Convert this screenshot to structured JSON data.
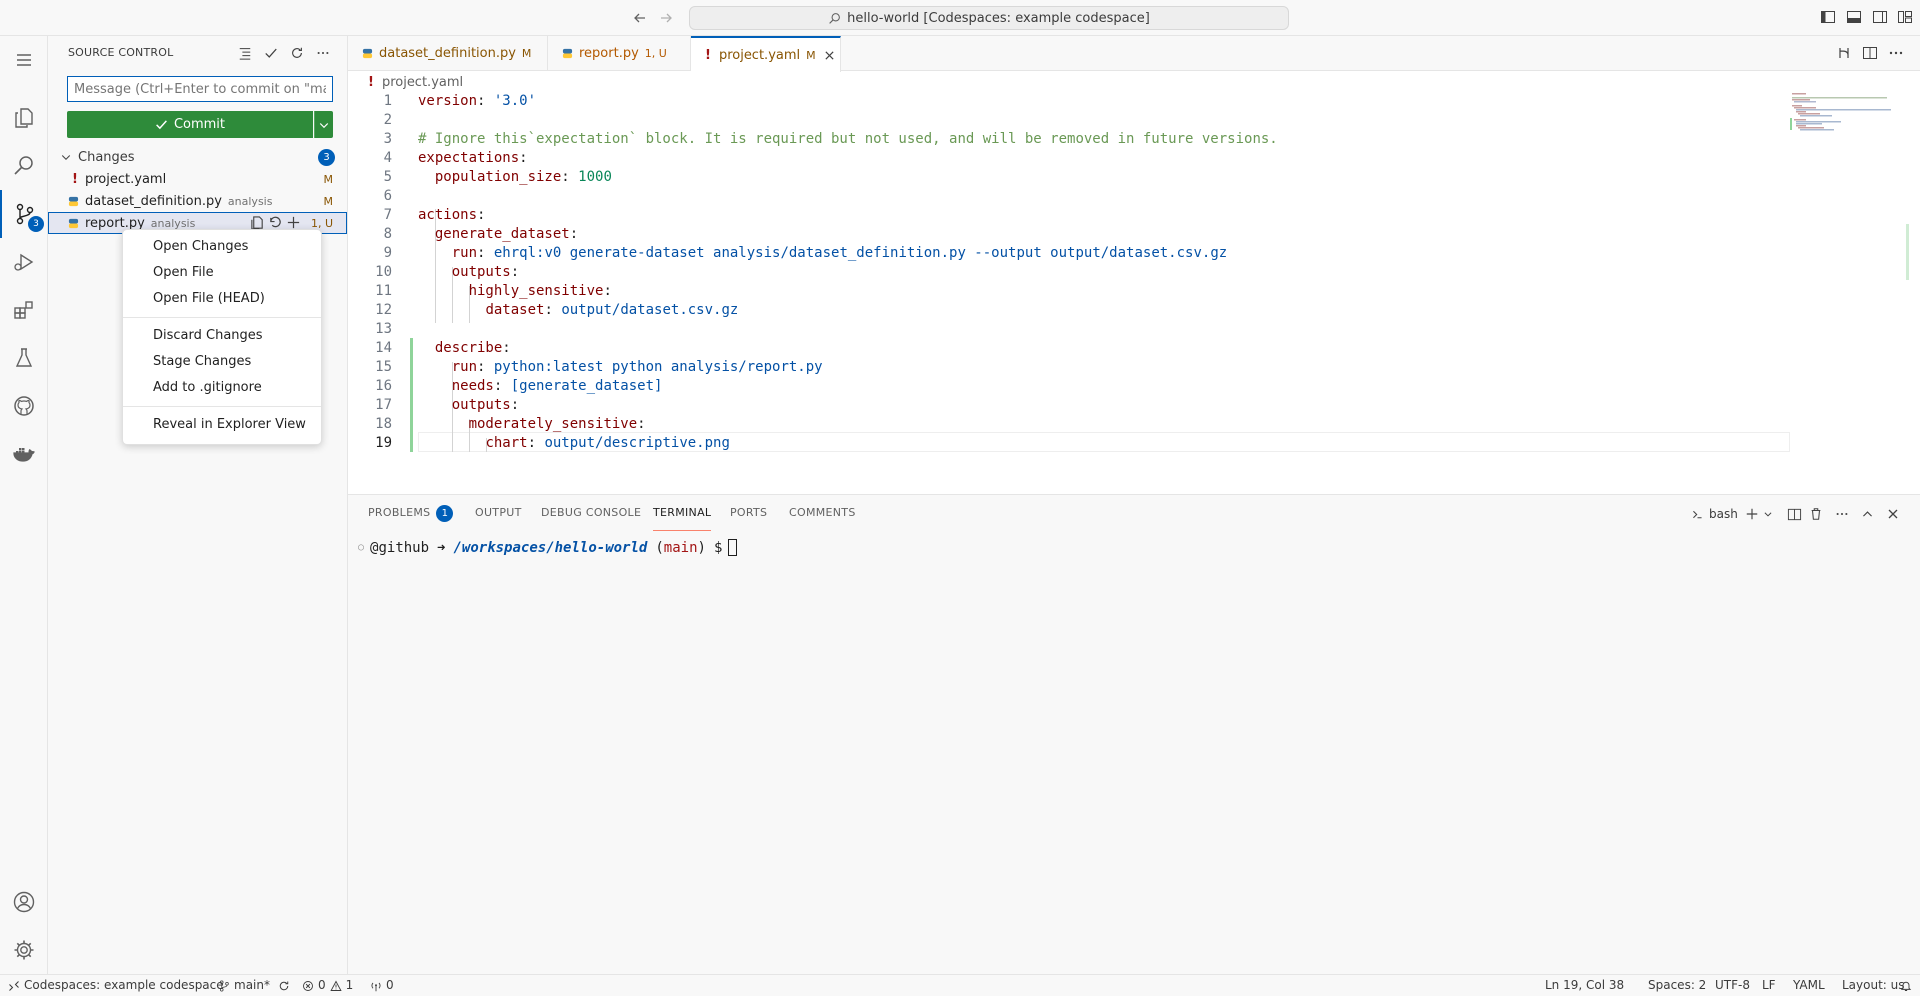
{
  "titlebar": {
    "command_center": "hello-world [Codespaces: example codespace]"
  },
  "activity": {
    "scm_badge": "3"
  },
  "sidebar": {
    "title": "SOURCE CONTROL",
    "commit_placeholder": "Message (Ctrl+Enter to commit on \"main\")",
    "commit_label": "Commit",
    "changes_label": "Changes",
    "changes_count": "3",
    "files": [
      {
        "icon": "!",
        "name": "project.yaml",
        "desc": "",
        "status": "M"
      },
      {
        "icon": "py",
        "name": "dataset_definition.py",
        "desc": "analysis",
        "status": "M"
      },
      {
        "icon": "py",
        "name": "report.py",
        "desc": "analysis",
        "status": "1, U"
      }
    ]
  },
  "context_menu": {
    "items": [
      "Open Changes",
      "Open File",
      "Open File (HEAD)",
      "Discard Changes",
      "Stage Changes",
      "Add to .gitignore",
      "Reveal in Explorer View"
    ]
  },
  "tabs": [
    {
      "name": "dataset_definition.py",
      "status": "M"
    },
    {
      "name": "report.py",
      "status": "1, U"
    },
    {
      "name": "project.yaml",
      "status": "M"
    }
  ],
  "breadcrumb": "project.yaml",
  "code": {
    "line_numbers": [
      "1",
      "2",
      "3",
      "4",
      "5",
      "6",
      "7",
      "8",
      "9",
      "10",
      "11",
      "12",
      "13",
      "14",
      "15",
      "16",
      "17",
      "18",
      "19"
    ],
    "l1_key": "version",
    "l1_val": "'3.0'",
    "l3": "# Ignore this`expectation` block. It is required but not used, and will be removed in future versions.",
    "l4_key": "expectations",
    "l5_key": "population_size",
    "l5_val": "1000",
    "l7_key": "actions",
    "l8_key": "generate_dataset",
    "l9_key": "run",
    "l9_val": "ehrql:v0 generate-dataset analysis/dataset_definition.py --output output/dataset.csv.gz",
    "l10_key": "outputs",
    "l11_key": "highly_sensitive",
    "l12_key": "dataset",
    "l12_val": "output/dataset.csv.gz",
    "l14_key": "describe",
    "l15_key": "run",
    "l15_val": "python:latest python analysis/report.py",
    "l16_key": "needs",
    "l16_val": "[generate_dataset]",
    "l17_key": "outputs",
    "l18_key": "moderately_sensitive",
    "l19_key": "chart",
    "l19_val": "output/descriptive.png"
  },
  "panel": {
    "tabs": [
      "PROBLEMS",
      "OUTPUT",
      "DEBUG CONSOLE",
      "TERMINAL",
      "PORTS",
      "COMMENTS"
    ],
    "problems_badge": "1",
    "shell": "bash",
    "term_user": "@github",
    "term_arrow": "➜",
    "term_path": "/workspaces/hello-world",
    "term_branch_open": "(",
    "term_branch": "main",
    "term_branch_close": ")",
    "term_prompt": "$"
  },
  "statusbar": {
    "remote": "Codespaces: example codespace",
    "branch": "main*",
    "errors": "0",
    "warnings": "1",
    "ports": "0",
    "position": "Ln 19, Col 38",
    "spaces": "Spaces: 2",
    "encoding": "UTF-8",
    "eol": "LF",
    "language": "YAML",
    "layout": "Layout: us"
  }
}
